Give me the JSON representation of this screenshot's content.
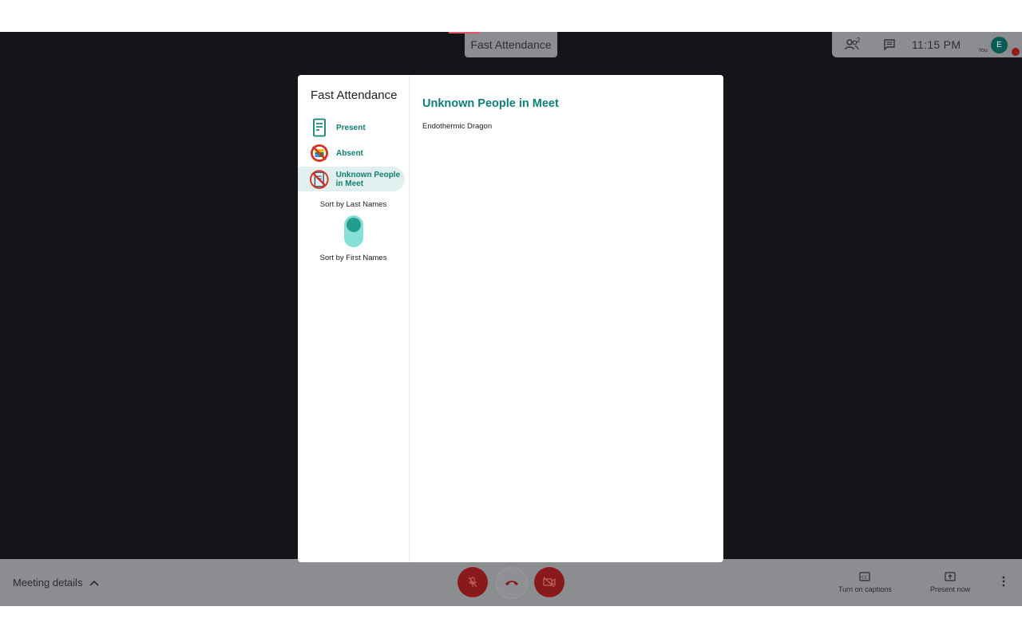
{
  "meet": {
    "tab_title": "Fast Attendance",
    "participants_count": "2",
    "clock": "11:15 PM",
    "you_label": "You",
    "avatar_initial": "E"
  },
  "bottom_bar": {
    "meeting_details": "Meeting details",
    "captions_label": "Turn on captions",
    "present_label": "Present now"
  },
  "panel": {
    "app_title": "Fast Attendance",
    "nav": [
      {
        "label": "Present",
        "icon": "document-icon"
      },
      {
        "label": "Absent",
        "icon": "absent-icon"
      },
      {
        "label": "Unknown People in Meet",
        "icon": "unknown-people-icon",
        "active": true
      }
    ],
    "sort_last": "Sort by Last Names",
    "sort_first": "Sort by First Names",
    "content_title": "Unknown People in Meet",
    "people": [
      "Endothermic Dragon"
    ]
  },
  "colors": {
    "accent": "#0f8174",
    "toggle_track": "#85e0d8",
    "toggle_knob": "#239e8e",
    "mic_red": "#8a1a1a"
  }
}
